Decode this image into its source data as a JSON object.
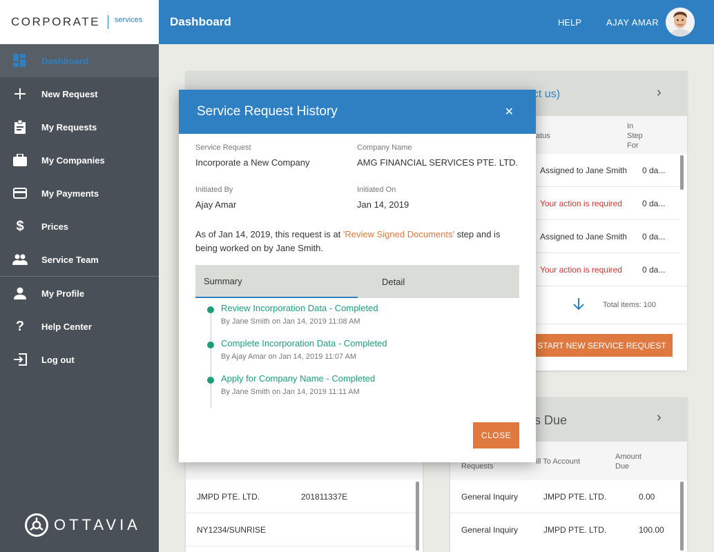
{
  "brand": {
    "main": "CORPORATE",
    "sub": "services",
    "logo": "OTTAVIA"
  },
  "header": {
    "title": "Dashboard",
    "help": "HELP",
    "user": "AJAY AMAR"
  },
  "sidebar": {
    "items": [
      {
        "label": "Dashboard",
        "icon": "dashboard-icon"
      },
      {
        "label": "New Request",
        "icon": "plus-icon"
      },
      {
        "label": "My Requests",
        "icon": "clipboard-icon"
      },
      {
        "label": "My Companies",
        "icon": "briefcase-icon"
      },
      {
        "label": "My Payments",
        "icon": "credit-card-icon"
      },
      {
        "label": "Prices",
        "icon": "dollar-icon"
      },
      {
        "label": "Service Team",
        "icon": "team-icon"
      },
      {
        "label": "My Profile",
        "icon": "person-icon"
      },
      {
        "label": "Help Center",
        "icon": "question-icon"
      },
      {
        "label": "Log out",
        "icon": "logout-icon"
      }
    ]
  },
  "bg_requests": {
    "title_fragment": "act us)",
    "col_status": "atus",
    "col_step": "In\nStep\nFor",
    "rows": [
      {
        "status": "Assigned to Jane Smith",
        "days": "0 da..."
      },
      {
        "status": "Your action is required",
        "days": "0 da..."
      },
      {
        "status": "Assigned to Jane Smith",
        "days": "0 da..."
      },
      {
        "status": "Your action is required",
        "days": "0 da..."
      }
    ],
    "total": "Total items: 100",
    "start_button": "START NEW SERVICE REQUEST"
  },
  "bg_payments": {
    "title_fragment": "s Due",
    "col_requests": "Requests",
    "col_bill": "ill To Account",
    "col_amount": "Amount\nDue",
    "rows": [
      {
        "request": "General Inquiry",
        "account": "JMPD PTE. LTD.",
        "amount": "0.00"
      },
      {
        "request": "General Inquiry",
        "account": "JMPD PTE. LTD.",
        "amount": "100.00"
      }
    ]
  },
  "bg_companies": {
    "rows": [
      {
        "name": "JMPD PTE. LTD.",
        "uen": "201811337E"
      },
      {
        "name": "NY1234/SUNRISE",
        "uen": ""
      }
    ]
  },
  "modal": {
    "title": "Service Request History",
    "service_request_label": "Service Request",
    "service_request_value": "Incorporate a New Company",
    "company_name_label": "Company Name",
    "company_name_value": "AMG FINANCIAL SERVICES PTE. LTD.",
    "initiated_by_label": "Initiated By",
    "initiated_by_value": "Ajay Amar",
    "initiated_on_label": "Initiated On",
    "initiated_on_value": "Jan 14, 2019",
    "para_pre": "As of Jan 14, 2019, this request is at ",
    "para_step": "'Review Signed Documents'",
    "para_post": " step and is being worked on by Jane Smith.",
    "tabs": [
      "Summary",
      "Detail"
    ],
    "timeline": [
      {
        "title": "Review Incorporation Data - Completed",
        "sub": "By Jane Smith on Jan 14, 2019 11:08 AM"
      },
      {
        "title": "Complete Incorporation Data - Completed",
        "sub": "By Ajay Amar on Jan 14, 2019 11:07 AM"
      },
      {
        "title": "Apply for Company Name - Completed",
        "sub": "By Jane Smith on Jan 14, 2019 11:11 AM"
      }
    ],
    "close_button": "CLOSE"
  },
  "colors": {
    "primary": "#2f80c2",
    "accent": "#e0793f",
    "success": "#1d9e74",
    "danger": "#d0342c",
    "sidebar": "#4a5058"
  }
}
